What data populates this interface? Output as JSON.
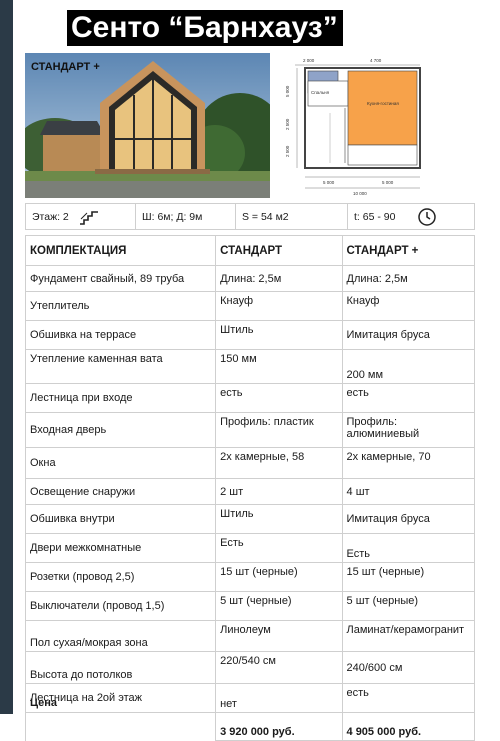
{
  "title": "Сенто “Барнхауз”",
  "photo_label": "СТАНДАРТ +",
  "plan": {
    "dim_total": "10 000",
    "dim_parts": [
      "5 000",
      "5 000"
    ],
    "dim_top": [
      "2 000",
      "4 700"
    ],
    "dim_left": "5 000",
    "dim_left_parts": [
      "2 500",
      "2 500"
    ],
    "room_main": "Кухня-гостиная",
    "room_small": "Спальня"
  },
  "params": {
    "floors": "Этаж: 2",
    "size": "Ш: 6м; Д: 9м",
    "area": "S = 54 м2",
    "time": "t: 65 - 90"
  },
  "table": {
    "headers": [
      "КОМПЛЕКТАЦИЯ",
      "СТАНДАРТ",
      "СТАНДАРТ +"
    ],
    "rows": [
      [
        "Фундамент свайный, 89 труба",
        "Длина: 2,5м",
        "Длина: 2,5м"
      ],
      [
        "Утеплитель",
        "Кнауф",
        "Кнауф"
      ],
      [
        "Обшивка на террасе",
        "Штиль",
        "Имитация бруса"
      ],
      [
        "Утепление каменная вата",
        "150 мм",
        "200 мм"
      ],
      [
        "Лестница при входе",
        "есть",
        "есть"
      ],
      [
        "Входная дверь",
        "Профиль: пластик",
        "Профиль: алюминиевый"
      ],
      [
        "Окна",
        "2х камерные, 58",
        "2х камерные, 70"
      ],
      [
        "Освещение снаружи",
        "2 шт",
        "4 шт"
      ],
      [
        "Обшивка внутри",
        "Штиль",
        "Имитация бруса"
      ],
      [
        "Двери межкомнатные",
        "Есть",
        "Есть"
      ],
      [
        "Розетки (провод 2,5)",
        "15 шт (черные)",
        "15 шт (черные)"
      ],
      [
        "Выключатели (провод 1,5)",
        "5 шт (черные)",
        "5 шт (черные)"
      ],
      [
        "Пол сухая/мокрая зона",
        "Линолеум",
        "Ламинат/керамогранит"
      ],
      [
        "Высота до потолков",
        "220/540 см",
        "240/600 см"
      ],
      [
        "Лестница на 2ой этаж",
        "нет",
        "есть"
      ]
    ],
    "price_label": "Цена",
    "prices": [
      "3 920 000 руб.",
      "4 905 000 руб."
    ]
  },
  "icons": [
    "stairs-icon",
    "clock-icon"
  ],
  "colors": {
    "plan_room_main": "#f7a24a",
    "plan_room_small": "#8fa3c8",
    "side_strip": "#2b3a47",
    "title_bg": "#000000"
  }
}
